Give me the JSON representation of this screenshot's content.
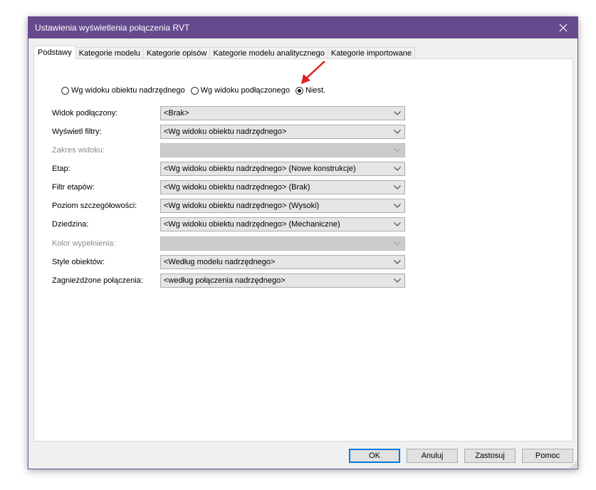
{
  "dialog": {
    "title": "Ustawienia wyświetlenia połączenia RVT",
    "close_icon": "close-icon"
  },
  "tabs": [
    {
      "label": "Podstawy",
      "active": true
    },
    {
      "label": "Kategorie modelu",
      "active": false
    },
    {
      "label": "Kategorie opisów",
      "active": false
    },
    {
      "label": "Kategorie modelu analitycznego",
      "active": false
    },
    {
      "label": "Kategorie importowane",
      "active": false
    }
  ],
  "radios": [
    {
      "label": "Wg widoku obiektu nadrzędnego",
      "checked": false
    },
    {
      "label": "Wg widoku podłączonego",
      "checked": false
    },
    {
      "label": "Niest.",
      "checked": true
    }
  ],
  "fields": [
    {
      "label": "Widok podłączony:",
      "value": "<Brak>",
      "enabled": true
    },
    {
      "label": "Wyświetl filtry:",
      "value": "<Wg widoku obiektu nadrzędnego>",
      "enabled": true
    },
    {
      "label": "Zakres widoku:",
      "value": "",
      "enabled": false
    },
    {
      "label": "Etap:",
      "value": "<Wg widoku obiektu nadrzędnego> (Nowe konstrukcje)",
      "enabled": true
    },
    {
      "label": "Filtr etapów:",
      "value": "<Wg widoku obiektu nadrzędnego> (Brak)",
      "enabled": true
    },
    {
      "label": "Poziom szczegółowości:",
      "value": "<Wg widoku obiektu nadrzędnego> (Wysoki)",
      "enabled": true
    },
    {
      "label": "Dziedzina:",
      "value": "<Wg widoku obiektu nadrzędnego> (Mechaniczne)",
      "enabled": true
    },
    {
      "label": "Kolor wypełnienia:",
      "value": "",
      "enabled": false
    },
    {
      "label": "Style obiektów:",
      "value": "<Według modelu nadrzędnego>",
      "enabled": true
    },
    {
      "label": "Zagnieżdżone połączenia:",
      "value": "<według połączenia nadrzędnego>",
      "enabled": true
    }
  ],
  "buttons": {
    "ok": "OK",
    "cancel": "Anuluj",
    "apply": "Zastosuj",
    "help": "Pomoc"
  },
  "colors": {
    "titlebar": "#654a8e",
    "annotation_arrow": "#e02020",
    "default_button_border": "#0078d7"
  }
}
